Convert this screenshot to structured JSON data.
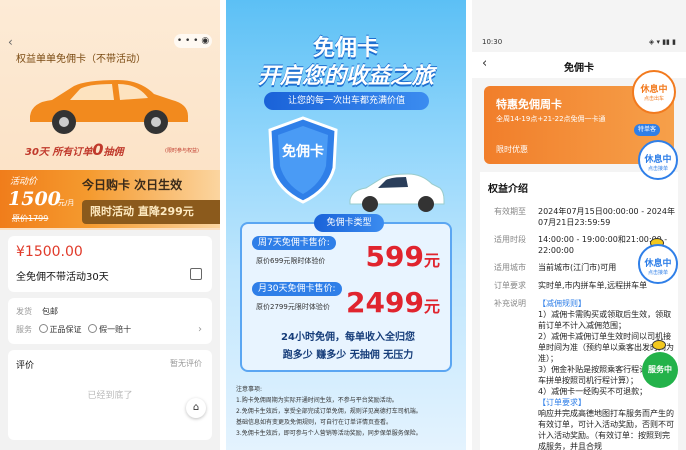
{
  "panel1": {
    "back": "‹",
    "title": "权益单单免佣卡（不带活动）",
    "promo_prefix": "30天  所有订单",
    "promo_zero": "0",
    "promo_suffix": "抽佣",
    "promo_note": "(限时参与权益)",
    "price_label": "活动价",
    "price_value": "1500",
    "price_unit": "元/月",
    "orig_price": "原价1799",
    "slogan": "今日购卡  次日生效",
    "limit_text": "限时活动  直降299元",
    "amount": "¥1500.00",
    "product_name": "全免佣不带活动30天",
    "ship_label": "发货",
    "ship_value": "包邮",
    "service_label": "服务",
    "service_1": "正品保证",
    "service_2": "假一赔十",
    "review_label": "评价",
    "review_empty": "暂无评价",
    "end_text": "已经到底了"
  },
  "panel2": {
    "title1": "免佣卡",
    "title2": "开启您的收益之旅",
    "pill": "让您的每一次出车都充满价值",
    "shield_text": "免佣卡",
    "type_tag": "免佣卡类型",
    "week_label": "周7天免佣卡售价:",
    "week_orig": "原价699元限时体验价",
    "week_price": "599",
    "month_label": "月30天免佣卡售价:",
    "month_orig": "原价2799元限时体验价",
    "month_price": "2499",
    "yuan": "元",
    "slogan1": "24小时免佣，每单收入全归您",
    "slogan2": "跑多少  赚多少  无抽佣  无压力",
    "notes_title": "注意事项:",
    "note1": "1.购卡免佣周期为实际开通时间生效，不参与平台奖励活动。",
    "note2": "2.免佣卡生效后，享受全部完成订单免佣，规则详见高德打车司机端。",
    "note3": "基础信息如有变更及免佣规则，可自行在订单详情页查看。",
    "note4": "3.免佣卡生效后，即可参与个人营销等活动奖励，同步保单服务保险。"
  },
  "panel3": {
    "status_time": "10:30",
    "status_right": "◈ ▾ ▮▮ ▮",
    "back": "‹",
    "title": "免佣卡",
    "card_title": "特惠免佣周卡",
    "card_sub": "全周14-19点+21-22点免佣一卡通",
    "card_bottom": "限时优惠",
    "section_title": "权益介绍",
    "k_valid": "有效期至",
    "v_valid": "2024年07月15日00:00:00 - 2024年07月21日23:59:59",
    "k_time": "适用时段",
    "v_time": "14:00:00 - 19:00:00和21:00:00 - 22:00:00",
    "k_city": "适用城市",
    "v_city": "当前城市(江门市)可用",
    "k_order": "订单要求",
    "v_order": "实时单,市内拼车单,远程拼车单",
    "k_note": "补充说明",
    "note_h1": "【减佣规则】",
    "note_1": "1）减佣卡需购买或领取后生效，领取前订单不计入减佣范围；",
    "note_2": "2）减佣卡减佣订单生效时间以司机接单时间为准（预约单以乘客出发时间为准）；",
    "note_3": "3）佣金补贴是按照乘客行程计算（拼车拼单按照司机行程计算）；",
    "note_4": "4）减佣卡一经购买不可退款；",
    "note_h2": "【订单要求】",
    "note_5": "响应并完成高德地图打车服务而产生的有效订单，可计入活动奖励，否则不可计入活动奖励。（有效订单：按照到完成服务，并且合规",
    "float1_t1": "休息中",
    "float1_t2": "点击出车",
    "float2_t1": "休息中",
    "float2_t2": "点击接单",
    "float3_t1": "休息中",
    "float3_t2": "点击接单",
    "tag_small": "特单客",
    "service": "服务中"
  }
}
